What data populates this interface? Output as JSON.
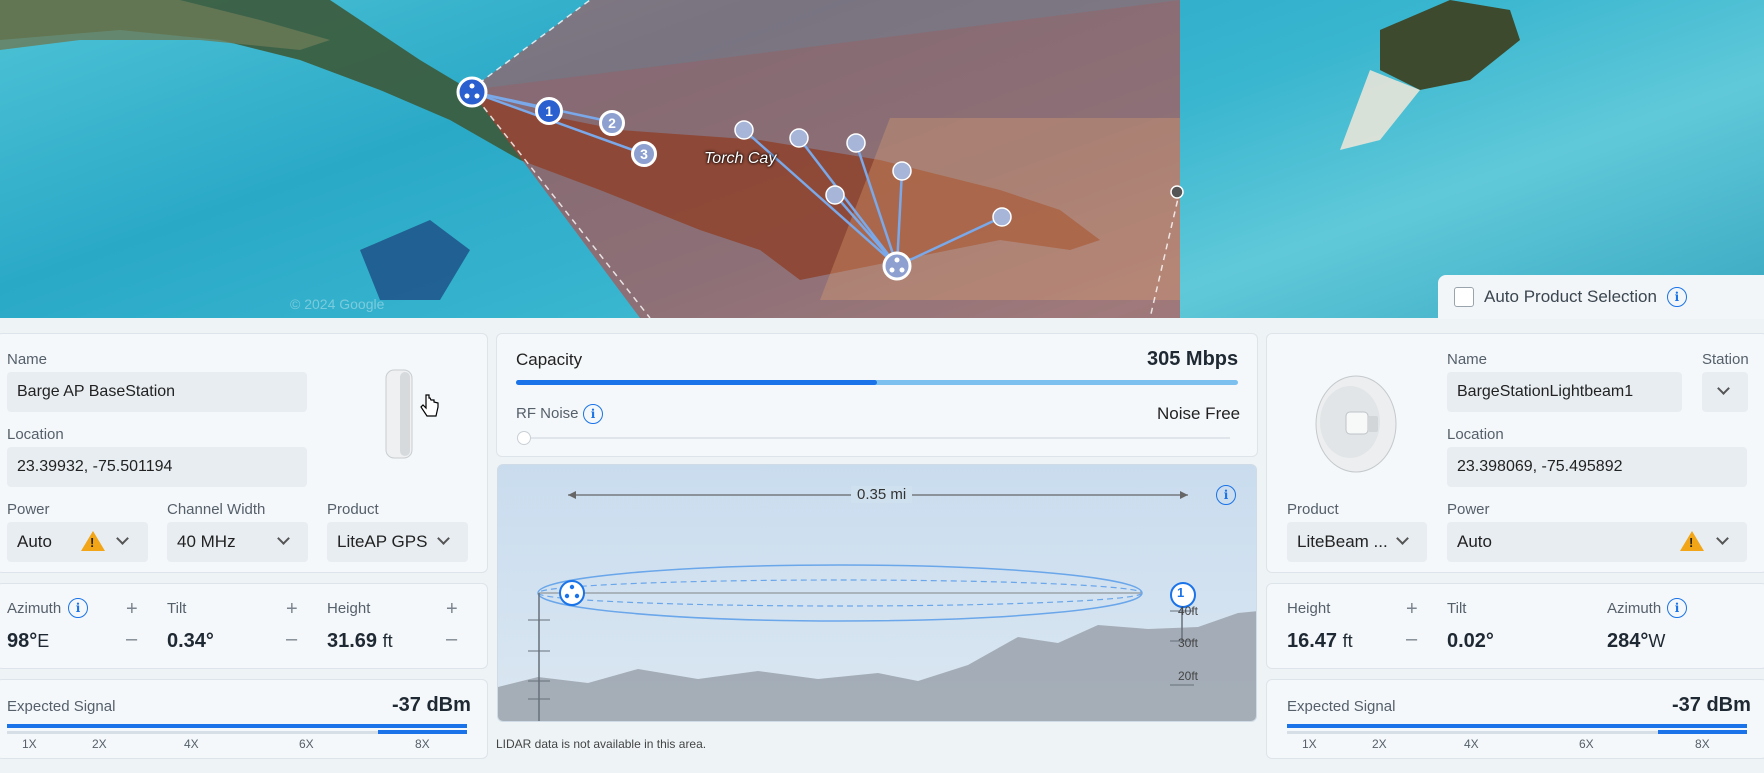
{
  "map": {
    "place_label": "Torch Cay",
    "watermark": "© 2024 Google",
    "link_markers": [
      "1",
      "2",
      "3"
    ]
  },
  "auto_product": {
    "label": "Auto Product Selection",
    "checked": false
  },
  "ap": {
    "name_label": "Name",
    "name_value": "Barge AP BaseStation",
    "location_label": "Location",
    "location_value": "23.39932, -75.501194",
    "power_label": "Power",
    "power_value": "Auto",
    "channel_width_label": "Channel Width",
    "channel_width_value": "40 MHz",
    "product_label": "Product",
    "product_value": "LiteAP GPS",
    "azimuth_label": "Azimuth",
    "azimuth_value": "98°",
    "azimuth_dir": "E",
    "tilt_label": "Tilt",
    "tilt_value": "0.34°",
    "height_label": "Height",
    "height_value": "31.69",
    "height_unit": "ft",
    "signal_label": "Expected Signal",
    "signal_value": "-37 dBm",
    "signal_ticks": [
      "1X",
      "2X",
      "4X",
      "6X",
      "8X"
    ]
  },
  "center": {
    "capacity_label": "Capacity",
    "capacity_value": "305 Mbps",
    "capacity_fraction": 0.5,
    "rf_noise_label": "RF Noise",
    "rf_noise_value": "Noise Free",
    "distance": "0.35 mi",
    "ft_labels": [
      "40ft",
      "30ft",
      "20ft"
    ],
    "lidar_note": "LIDAR data is not available in this area.",
    "station_marker": "1"
  },
  "station": {
    "name_label": "Name",
    "name_value": "BargeStationLightbeam1",
    "station_label": "Station",
    "location_label": "Location",
    "location_value": "23.398069, -75.495892",
    "product_label": "Product",
    "product_value": "LiteBeam ...",
    "power_label": "Power",
    "power_value": "Auto",
    "height_label": "Height",
    "height_value": "16.47",
    "height_unit": "ft",
    "tilt_label": "Tilt",
    "tilt_value": "0.02°",
    "azimuth_label": "Azimuth",
    "azimuth_value": "284°",
    "azimuth_dir": "W",
    "signal_label": "Expected Signal",
    "signal_value": "-37 dBm",
    "signal_ticks": [
      "1X",
      "2X",
      "4X",
      "6X",
      "8X"
    ]
  },
  "colors": {
    "accent": "#1a73e8",
    "warning": "#f2a516",
    "coverage": "#d9342b"
  }
}
